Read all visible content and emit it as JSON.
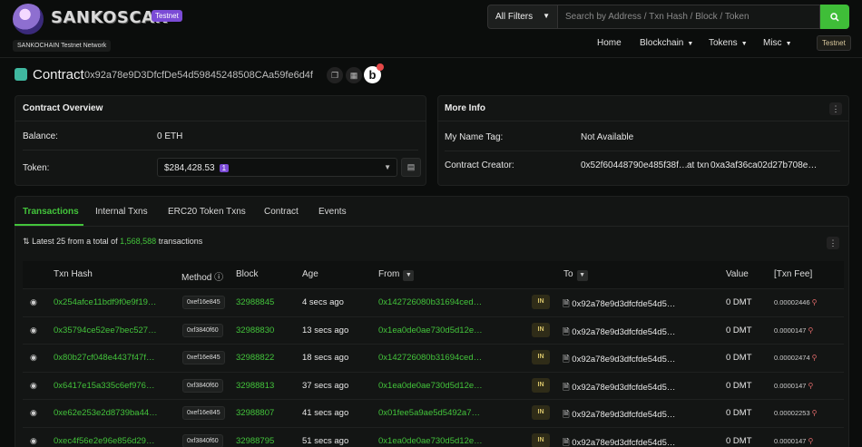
{
  "header": {
    "brand": "SANKOSCAN",
    "badge": "Testnet",
    "network": "SANKOCHAIN Testnet Network",
    "filter_label": "All Filters",
    "search_placeholder": "Search by Address / Txn Hash / Block / Token",
    "nav": [
      "Home",
      "Blockchain",
      "Tokens",
      "Misc"
    ],
    "nav_badge": "Testnet"
  },
  "contract": {
    "title": "Contract",
    "address": "0x92a78e9D3DfcfDe54d59845248508CAa59fe6d4f"
  },
  "overview": {
    "title": "Contract Overview",
    "balance_label": "Balance:",
    "balance_value": "0 ETH",
    "token_label": "Token:",
    "token_value": "$284,428.53",
    "token_count": "1"
  },
  "more_info": {
    "title": "More Info",
    "name_tag_label": "My Name Tag:",
    "name_tag_value": "Not Available",
    "creator_label": "Contract Creator:",
    "creator_address": "0x52f60448790e485f38f…",
    "at_txn": "at txn",
    "creator_txn": "0xa3af36ca02d27b708e…"
  },
  "tabs": [
    "Transactions",
    "Internal Txns",
    "ERC20 Token Txns",
    "Contract",
    "Events"
  ],
  "summary": {
    "prefix": "Latest 25 from a total of",
    "count": "1,568,588",
    "suffix": "transactions"
  },
  "table": {
    "headers": [
      "Txn Hash",
      "Method",
      "Block",
      "Age",
      "From",
      "To",
      "Value",
      "[Txn Fee]"
    ],
    "rows": [
      {
        "hash": "0x254afce11bdf9f0e9f19…",
        "method": "0xef16e845",
        "block": "32988845",
        "age": "4 secs ago",
        "from": "0x142726080b31694ced…",
        "dir": "IN",
        "to": "0x92a78e9d3dfcfde54d5…",
        "value": "0 DMT",
        "fee": "0.00002446"
      },
      {
        "hash": "0x35794ce52ee7bec527…",
        "method": "0xf3840f60",
        "block": "32988830",
        "age": "13 secs ago",
        "from": "0x1ea0de0ae730d5d12e…",
        "dir": "IN",
        "to": "0x92a78e9d3dfcfde54d5…",
        "value": "0 DMT",
        "fee": "0.0000147"
      },
      {
        "hash": "0x80b27cf048e4437f47f…",
        "method": "0xef16e845",
        "block": "32988822",
        "age": "18 secs ago",
        "from": "0x142726080b31694ced…",
        "dir": "IN",
        "to": "0x92a78e9d3dfcfde54d5…",
        "value": "0 DMT",
        "fee": "0.00002474"
      },
      {
        "hash": "0x6417e15a335c6ef976…",
        "method": "0xf3840f60",
        "block": "32988813",
        "age": "37 secs ago",
        "from": "0x1ea0de0ae730d5d12e…",
        "dir": "IN",
        "to": "0x92a78e9d3dfcfde54d5…",
        "value": "0 DMT",
        "fee": "0.0000147"
      },
      {
        "hash": "0xe62e253e2d8739ba44…",
        "method": "0xef16e845",
        "block": "32988807",
        "age": "41 secs ago",
        "from": "0x01fee5a9ae5d5492a7…",
        "dir": "IN",
        "to": "0x92a78e9d3dfcfde54d5…",
        "value": "0 DMT",
        "fee": "0.00002253"
      },
      {
        "hash": "0xec4f56e2e96e856d29…",
        "method": "0xf3840f60",
        "block": "32988795",
        "age": "51 secs ago",
        "from": "0x1ea0de0ae730d5d12e…",
        "dir": "IN",
        "to": "0x92a78e9d3dfcfde54d5…",
        "value": "0 DMT",
        "fee": "0.0000147"
      }
    ]
  },
  "colors": {
    "accent": "#43c43b",
    "badge_purple": "#7b4bd6",
    "background": "#0b0d0c"
  },
  "icons": [
    "search-icon",
    "copy-icon",
    "qr-icon",
    "eye-icon",
    "filter-icon",
    "kebab-icon",
    "wallet-icon",
    "document-icon",
    "pin-icon"
  ]
}
